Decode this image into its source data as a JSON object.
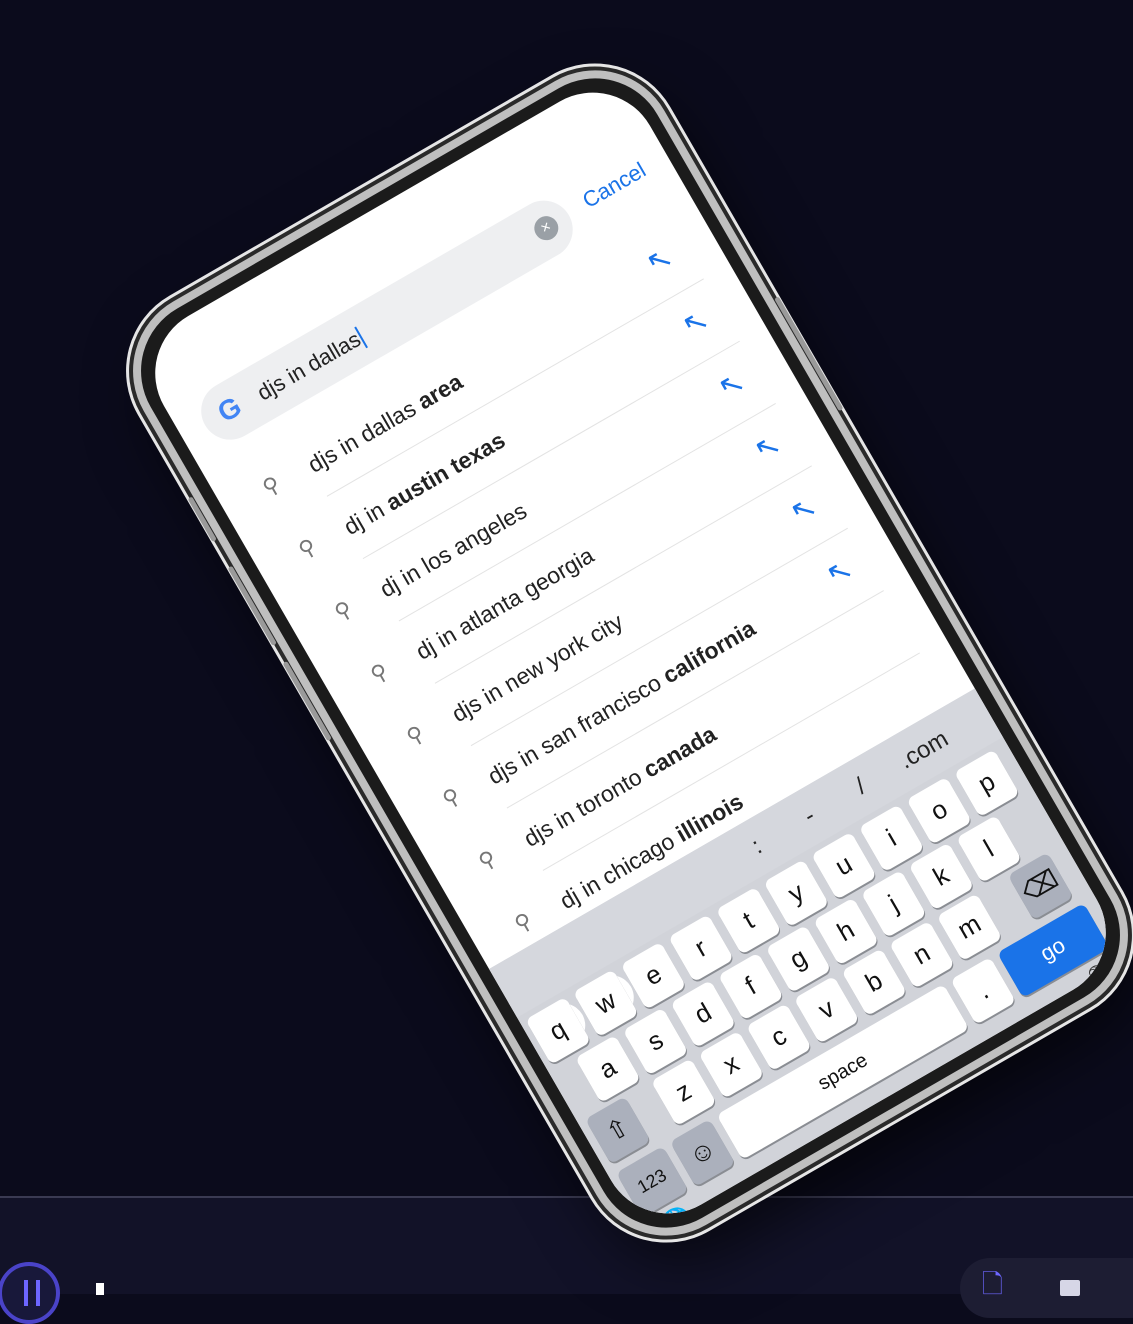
{
  "search": {
    "logo": "G",
    "query": "djs in dallas",
    "cancel_label": "Cancel"
  },
  "suggestions": [
    {
      "prefix": "djs in dallas ",
      "bold": "area"
    },
    {
      "prefix": "dj in ",
      "bold": "austin texas"
    },
    {
      "prefix": "dj in los angeles",
      "bold": ""
    },
    {
      "prefix": "dj in atlanta georgia",
      "bold": ""
    },
    {
      "prefix": "djs in new york city",
      "bold": ""
    },
    {
      "prefix": "djs in san francisco ",
      "bold": "california"
    },
    {
      "prefix": "djs in toronto ",
      "bold": "canada"
    },
    {
      "prefix": "dj in chicago ",
      "bold": "illinois"
    }
  ],
  "keyboard": {
    "symbols": [
      ":",
      "-",
      "/",
      ".com"
    ],
    "row1": [
      "q",
      "w",
      "e",
      "r",
      "t",
      "y",
      "u",
      "i",
      "o",
      "p"
    ],
    "row2": [
      "a",
      "s",
      "d",
      "f",
      "g",
      "h",
      "j",
      "k",
      "l"
    ],
    "row3": [
      "z",
      "x",
      "c",
      "v",
      "b",
      "n",
      "m"
    ],
    "numbers_label": "123",
    "space_label": "space",
    "period_label": ".",
    "go_label": "go"
  },
  "colors": {
    "accent": "#1a73e8",
    "background": "#0b0b1c",
    "brand": "#4a43c8"
  }
}
